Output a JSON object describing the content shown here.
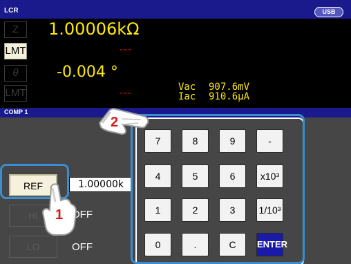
{
  "header": {
    "title": "LCR",
    "usb_label": "USB"
  },
  "measurement": {
    "param1_label": "Z",
    "lmt_label": "LMT",
    "param2_label": "θ",
    "value1": "1.00006kΩ",
    "dash1": "---",
    "value2": "-0.004 °",
    "dash2": "---",
    "vac_label": "Vac",
    "vac_value": "907.6mV",
    "iac_label": "Iac",
    "iac_value": "910.6μA"
  },
  "comp_bar": {
    "title": "COMP 1"
  },
  "left_panel": {
    "ref_button": "REF",
    "ref_value": "1.00000k",
    "hi_button": "HI",
    "hi_value": "OFF",
    "lo_button": "LO",
    "lo_value": "OFF"
  },
  "keypad": {
    "keys": [
      "7",
      "8",
      "9",
      "-",
      "4",
      "5",
      "6",
      "x10³",
      "1",
      "2",
      "3",
      "1/10³",
      "0",
      ".",
      "C",
      "ENTER"
    ]
  },
  "annotations": {
    "step1": "1",
    "step2": "2"
  },
  "colors": {
    "header_blue": "#1a1a8c",
    "value_yellow": "#ffea00",
    "limit_red": "#e01010",
    "callout_blue": "#3a8dd0",
    "enter_blue": "#1a1aa8"
  }
}
